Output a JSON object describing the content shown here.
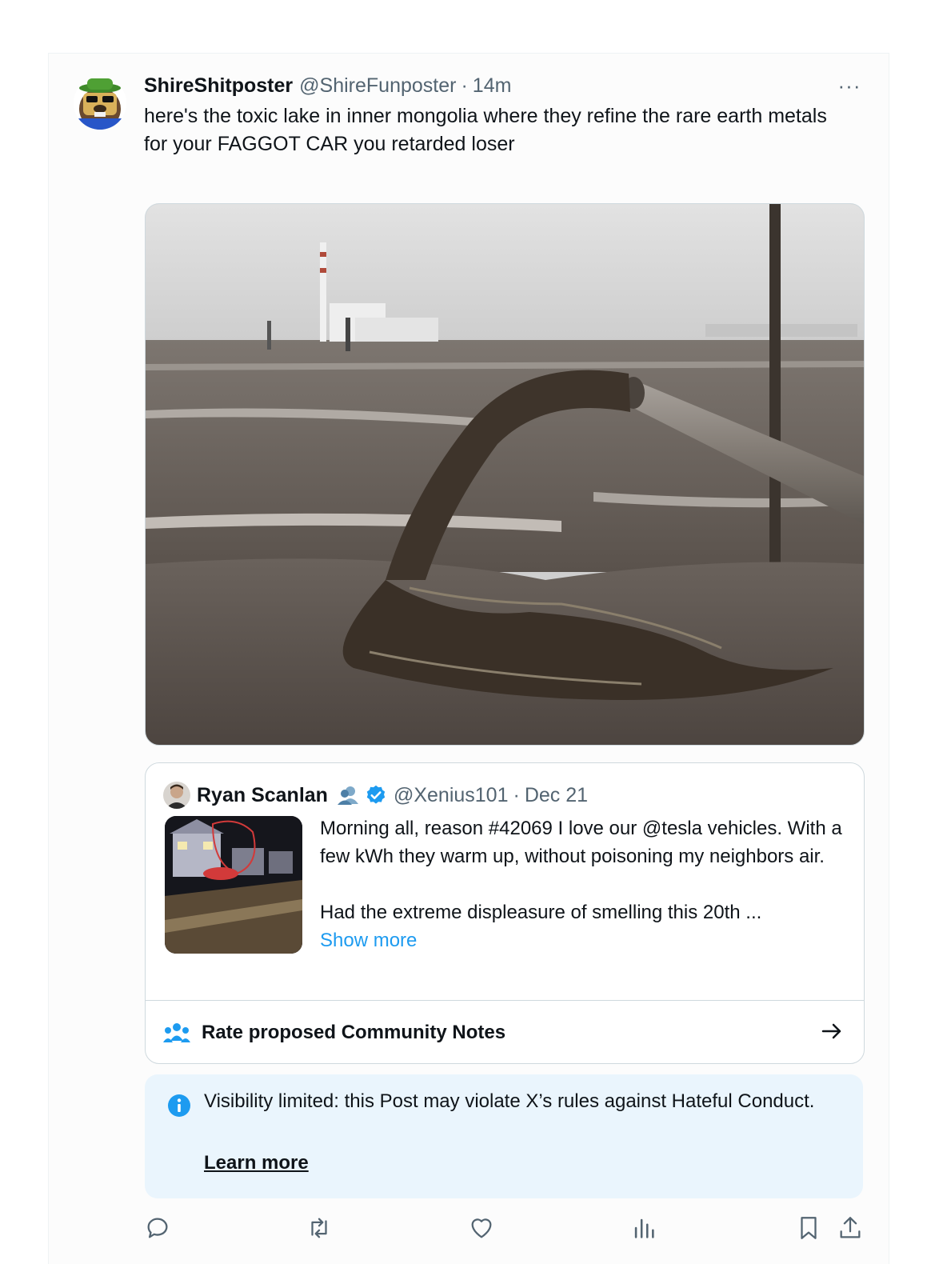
{
  "post": {
    "display_name": "ShireShitposter",
    "handle": "@ShireFunposter",
    "separator": "·",
    "time": "14m",
    "more_label": "···",
    "text": "here's the toxic lake in inner mongolia where they refine the rare earth metals for your FAGGOT CAR you retarded loser"
  },
  "quote": {
    "display_name": "Ryan Scanlan",
    "handle": "@Xenius101",
    "separator": "·",
    "date": "Dec 21",
    "text_line1": "Morning all, reason #42069 I love our @tesla vehicles. With a few kWh they warm up, without poisoning my neighbors air.",
    "text_line2": "Had the extreme displeasure of smelling this 20th ...",
    "show_more": "Show more",
    "community_notes_label": "Rate proposed Community Notes"
  },
  "visibility": {
    "message": "Visibility limited: this Post may violate X’s rules against Hateful Conduct.",
    "learn_more": "Learn more"
  },
  "colors": {
    "link_blue": "#1d9bf0",
    "secondary_text": "#536471",
    "notice_bg": "#eaf5fd",
    "verified_blue": "#1d9bf0"
  },
  "icons": [
    "reply-icon",
    "repost-icon",
    "like-icon",
    "views-icon",
    "bookmark-icon",
    "share-icon",
    "info-icon",
    "community-notes-icon",
    "arrow-right-icon",
    "verified-badge-icon",
    "affiliate-icon",
    "more-icon"
  ]
}
